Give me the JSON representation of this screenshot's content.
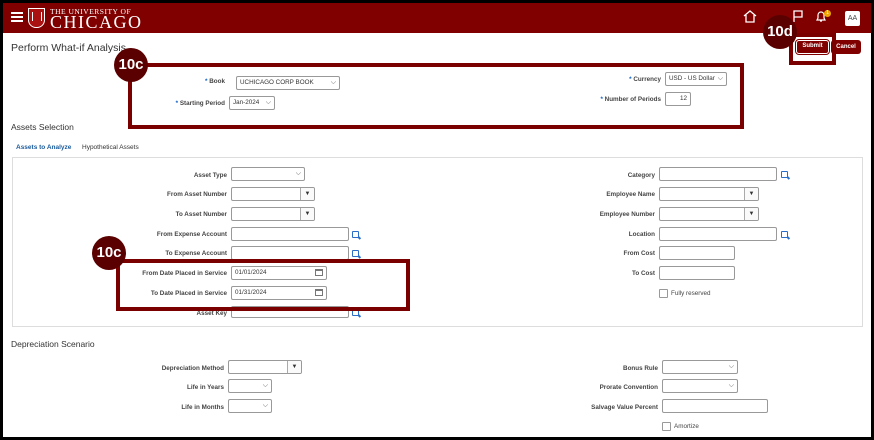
{
  "header": {
    "logo_small": "THE UNIVERSITY OF",
    "logo_big": "CHICAGO",
    "icons": [
      "menu-icon",
      "home-icon",
      "flag-icon",
      "bell-icon"
    ],
    "notification_count": "1",
    "avatar_initials": "AA"
  },
  "page": {
    "title": "Perform What-if Analysis",
    "submit_label": "Submit",
    "cancel_label": "Cancel"
  },
  "top_form": {
    "book_label": "Book",
    "book_value": "UCHICAGO CORP BOOK",
    "starting_period_label": "Starting Period",
    "starting_period_value": "Jan-2024",
    "currency_label": "Currency",
    "currency_value": "USD - US Dollar",
    "number_of_periods_label": "Number of Periods",
    "number_of_periods_value": "12"
  },
  "assets_selection": {
    "title": "Assets Selection",
    "tabs": [
      "Assets to Analyze",
      "Hypothetical Assets"
    ],
    "left": {
      "asset_type": "Asset Type",
      "from_asset_number": "From Asset Number",
      "to_asset_number": "To Asset Number",
      "from_expense_account": "From Expense Account",
      "to_expense_account": "To Expense Account",
      "from_date_label": "From Date Placed in Service",
      "from_date_value": "01/01/2024",
      "to_date_label": "To Date Placed in Service",
      "to_date_value": "01/31/2024",
      "asset_key": "Asset Key"
    },
    "right": {
      "category": "Category",
      "employee_name": "Employee Name",
      "employee_number": "Employee Number",
      "location": "Location",
      "from_cost": "From Cost",
      "to_cost": "To Cost",
      "fully_reserved": "Fully reserved"
    }
  },
  "depreciation": {
    "title": "Depreciation Scenario",
    "method": "Depreciation Method",
    "life_years": "Life in Years",
    "life_months": "Life in Months",
    "bonus_rule": "Bonus Rule",
    "prorate": "Prorate Convention",
    "salvage": "Salvage Value Percent",
    "amortize": "Amortize"
  },
  "callouts": {
    "c1": "10c",
    "c2": "10c",
    "c3": "10d",
    "color": "#7a0000"
  }
}
